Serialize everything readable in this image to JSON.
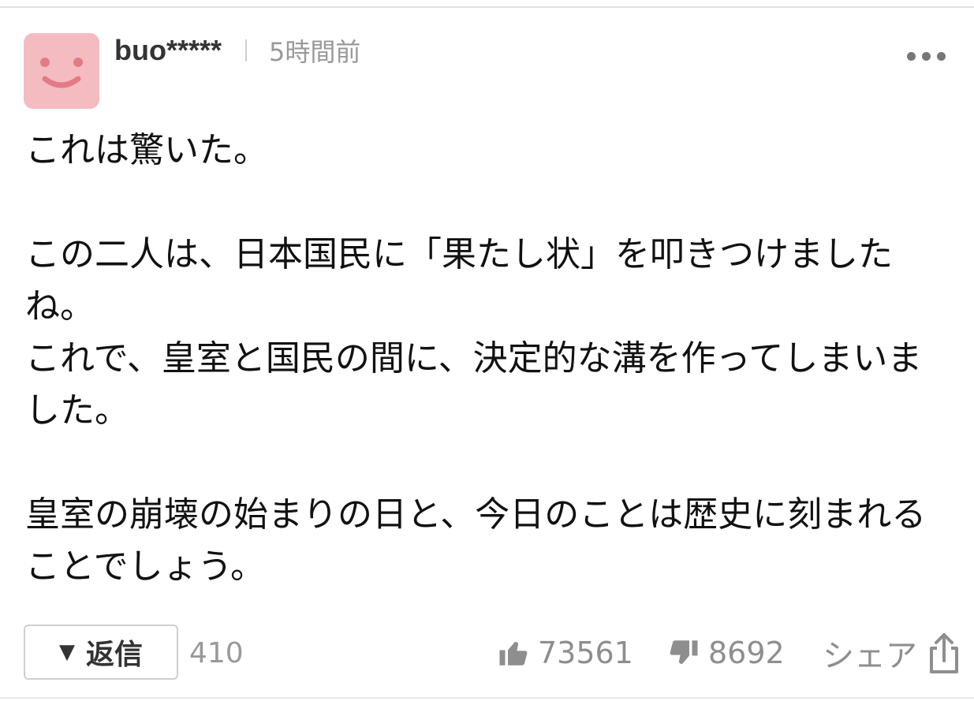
{
  "comment": {
    "username": "buo*****",
    "timestamp": "5時間前",
    "paragraphs": [
      "これは驚いた。",
      "この二人は、日本国民に「果たし状」を叩きつけましたね。\nこれで、皇室と国民の間に、決定的な溝を作ってしまいました。",
      "皇室の崩壊の始まりの日と、今日のことは歴史に刻まれることでしょう。"
    ]
  },
  "icons": {
    "avatar": "smiley-face-avatar",
    "more": "more-dots-icon",
    "reply_toggle": "triangle-down-icon",
    "like": "thumbs-up-icon",
    "dislike": "thumbs-down-icon",
    "share": "share-icon"
  },
  "actions": {
    "reply_label": "返信",
    "reply_count": "410",
    "like_count": "73561",
    "dislike_count": "8692",
    "share_label": "シェア"
  },
  "colors": {
    "avatar_bg": "#f4bcc1",
    "avatar_face": "#e37b87",
    "muted_text": "#999999",
    "icon_gray": "#8e8e8e"
  }
}
